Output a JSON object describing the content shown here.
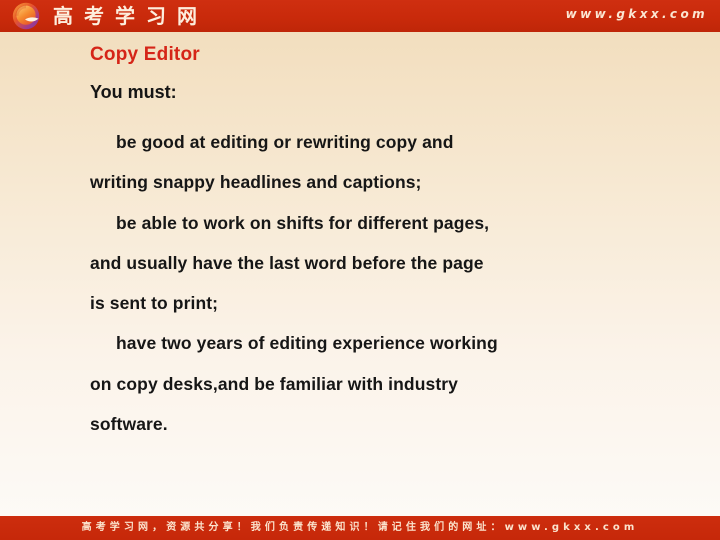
{
  "header": {
    "logo_icon": "gkxx-swirl-logo-icon",
    "brand_cn": "高考学习网",
    "brand_url": "www.gkxx.com",
    "background_color": "#c92a0b",
    "text_color": "#fdeedd"
  },
  "slide": {
    "title": "Copy Editor",
    "title_color": "#d52518",
    "lead": "You must:",
    "body_color": "#161616",
    "background_top": "#f1dcba",
    "background_bottom": "#fdfbf8",
    "lines": [
      {
        "text": "be good at editing or rewriting copy and",
        "indent": true
      },
      {
        "text": "writing snappy headlines and captions;",
        "indent": false
      },
      {
        "text": "be able to work on shifts for different pages,",
        "indent": true
      },
      {
        "text": "and usually have the last word before the page",
        "indent": false
      },
      {
        "text": "is sent to print;",
        "indent": false
      },
      {
        "text": "have two years of editing experience working",
        "indent": true
      },
      {
        "text": "on copy desks,and be familiar with industry",
        "indent": false
      },
      {
        "text": "software.",
        "indent": false
      }
    ]
  },
  "footer": {
    "text": "高考学习网，资源共分享！我们负责传递知识！请记住我们的网址：www.gkxx.com",
    "background_color": "#c62809",
    "text_color": "#fbe3cd"
  }
}
